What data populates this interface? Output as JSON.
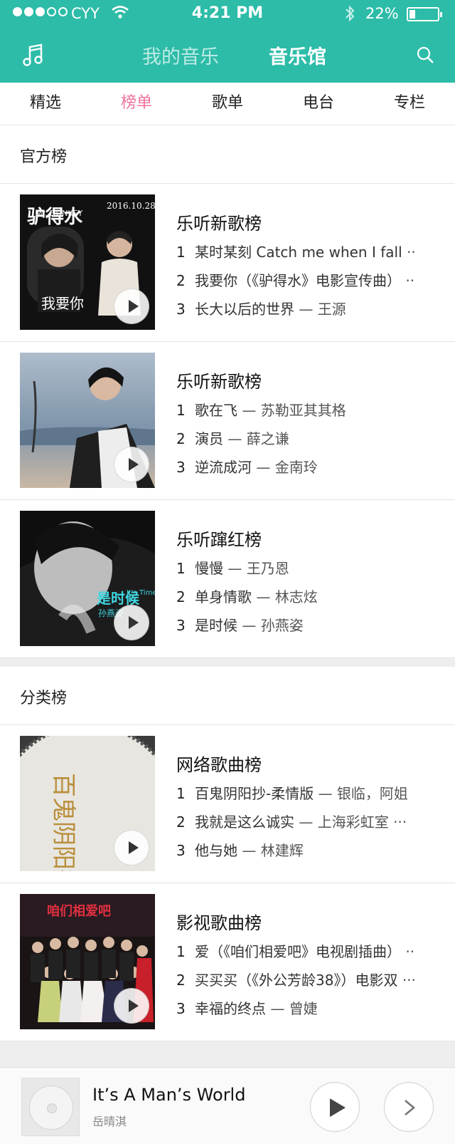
{
  "status": {
    "carrier": "CYY",
    "time": "4:21 PM",
    "battery": "22%",
    "battery_level": 0.22
  },
  "header": {
    "tab_mine": "我的音乐",
    "tab_hall": "音乐馆",
    "left_icon": "music-note-icon",
    "right_icon": "search-icon"
  },
  "subtabs": [
    {
      "label": "精选",
      "active": false
    },
    {
      "label": "榜单",
      "active": true
    },
    {
      "label": "歌单",
      "active": false
    },
    {
      "label": "电台",
      "active": false
    },
    {
      "label": "专栏",
      "active": false
    }
  ],
  "sections": {
    "official": {
      "title": "官方榜",
      "charts": [
        {
          "title": "乐听新歌榜",
          "cover_text": {
            "main": "驴得水",
            "date": "2016.10.28",
            "bottom": "我要你",
            "small": "Mr. DONKEY"
          },
          "songs": [
            {
              "n": "1",
              "name": "某时某刻 Catch me when I fall",
              "artist": "··"
            },
            {
              "n": "2",
              "name": "我要你（《驴得水》电影宣传曲）",
              "artist": "··"
            },
            {
              "n": "3",
              "name": "长大以后的世界",
              "artist": "— 王源"
            }
          ]
        },
        {
          "title": "乐听新歌榜",
          "cover_text": {
            "main": "",
            "date": "",
            "bottom": "",
            "small": ""
          },
          "songs": [
            {
              "n": "1",
              "name": "歌在飞",
              "artist": "— 苏勒亚其其格"
            },
            {
              "n": "2",
              "name": "演员",
              "artist": "— 薛之谦"
            },
            {
              "n": "3",
              "name": "逆流成河",
              "artist": "— 金南玲"
            }
          ]
        },
        {
          "title": "乐听蹿红榜",
          "cover_text": {
            "main": "是时候",
            "date": "",
            "bottom": "孙燕姿",
            "small": "It's Time"
          },
          "songs": [
            {
              "n": "1",
              "name": "慢慢",
              "artist": "— 王乃恩"
            },
            {
              "n": "2",
              "name": "单身情歌",
              "artist": "— 林志炫"
            },
            {
              "n": "3",
              "name": "是时候",
              "artist": "— 孙燕姿"
            }
          ]
        }
      ]
    },
    "category": {
      "title": "分类榜",
      "charts": [
        {
          "title": "网络歌曲榜",
          "cover_text": {
            "main": "百鬼阴阳抄",
            "date": "",
            "bottom": "",
            "small": ""
          },
          "songs": [
            {
              "n": "1",
              "name": "百鬼阴阳抄-柔情版",
              "artist": "— 银临，阿姐"
            },
            {
              "n": "2",
              "name": "我就是这么诚实",
              "artist": "— 上海彩虹室 ···"
            },
            {
              "n": "3",
              "name": "他与她",
              "artist": "— 林建辉"
            }
          ]
        },
        {
          "title": "影视歌曲榜",
          "cover_text": {
            "main": "咱们相爱吧",
            "date": "",
            "bottom": "",
            "small": ""
          },
          "songs": [
            {
              "n": "1",
              "name": "爱（《咱们相爱吧》电视剧插曲）",
              "artist": "··"
            },
            {
              "n": "2",
              "name": "买买买（《外公芳龄38》）电影双",
              "artist": "···"
            },
            {
              "n": "3",
              "name": "幸福的终点",
              "artist": "— 曾婕"
            }
          ]
        }
      ]
    }
  },
  "player": {
    "song": "It’s  A Man’s World",
    "singer": "岳晴淇"
  }
}
